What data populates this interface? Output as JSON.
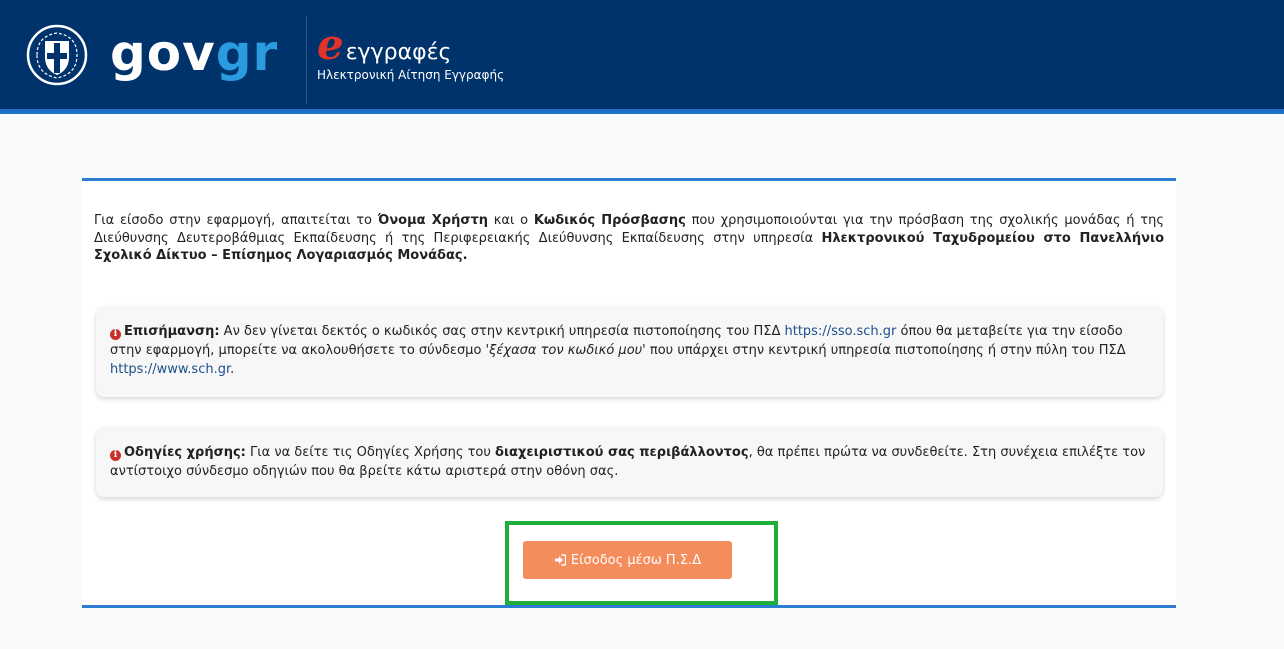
{
  "header": {
    "logo_gov": "gov",
    "logo_gr": "gr",
    "app_initial": "e",
    "app_name": "εγγραφές",
    "app_subtitle": "Ηλεκτρονική Αίτηση Εγγραφής",
    "emblem_icon": "greek-state-emblem-icon"
  },
  "intro": {
    "part1": "Για είσοδο στην εφαρμογή, απαιτείται το ",
    "username_label": "Όνομα Χρήστη",
    "part2": " και ο ",
    "password_label": "Κωδικός Πρόσβασης",
    "part3": " που χρησιμοποιούνται για την πρόσβαση της σχολικής μονάδας ή της Διεύθυνσης Δευτεροβάθμιας Εκπαίδευσης ή της Περιφερειακής Διεύθυνσης Εκπαίδευσης στην υπηρεσία ",
    "service_name": "Ηλεκτρονικού Ταχυδρομείου στο Πανελλήνιο Σχολικό Δίκτυο – Επίσημος Λογαριασμός Μονάδας."
  },
  "notice_1": {
    "icon": "info-circle-icon",
    "title": "Επισήμανση:",
    "text1": " Αν δεν γίνεται δεκτός ο κωδικός σας στην κεντρική υπηρεσία πιστοποίησης του ΠΣΔ ",
    "link1": "https://sso.sch.gr",
    "text2": " όπου θα μεταβείτε για την είσοδο στην εφαρμογή, μπορείτε να ακολουθήσετε το σύνδεσμο ",
    "forgot_link_text": "'ξέχασα τον κωδικό μου'",
    "text3": " που υπάρχει στην κεντρική υπηρεσία πιστοποίησης ή στην πύλη του ΠΣΔ ",
    "link2": "https://www.sch.gr",
    "text4": "."
  },
  "notice_2": {
    "icon": "info-circle-icon",
    "title": "Οδηγίες χρήσης:",
    "text1": " Για να δείτε τις Οδηγίες Χρήσης του ",
    "bold1": "διαχειριστικού σας περιβάλλοντος",
    "text2": ", θα πρέπει πρώτα να συνδεθείτε. Στη συνέχεια επιλέξτε τον αντίστοιχο σύνδεσμο οδηγιών που θα βρείτε κάτω αριστερά στην οθόνη σας."
  },
  "login_button": {
    "icon": "sign-in-icon",
    "label": "Είσοδος μέσω Π.Σ.Δ"
  },
  "colors": {
    "header_bg": "#00336b",
    "accent_blue": "#2a7dd1",
    "button_orange": "#f48c5c",
    "highlight_green": "#1fae3a",
    "info_red": "#c8302b"
  }
}
